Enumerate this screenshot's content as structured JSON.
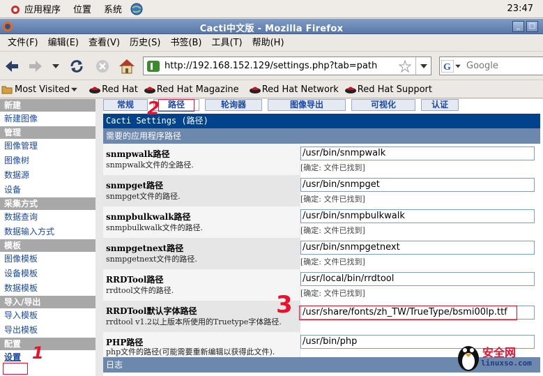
{
  "panel": {
    "apps": "应用程序",
    "places": "位置",
    "system": "系统",
    "clock": "23:47"
  },
  "window": {
    "title": "Cacti中文版 - Mozilla Firefox"
  },
  "menubar": [
    "文件(F)",
    "编辑(E)",
    "查看(V)",
    "历史(S)",
    "书签(B)",
    "工具(T)",
    "帮助(H)"
  ],
  "nav": {
    "url": "http://192.168.152.129/settings.php?tab=path",
    "search_placeholder": "Google"
  },
  "bookmarks": {
    "most_visited": "Most Visited",
    "items": [
      "Red Hat",
      "Red Hat Magazine",
      "Red Hat Network",
      "Red Hat Support"
    ]
  },
  "sidebar": {
    "h_new": "新建",
    "new_graph": "新建图像",
    "h_manage": "管理",
    "graph_mgmt": "图像管理",
    "graph_tree": "图像树",
    "data_source": "数据源",
    "device": "设备",
    "h_collect": "采集方式",
    "data_query": "数据查询",
    "data_input": "数据输入方式",
    "h_template": "模板",
    "graph_tpl": "图像模板",
    "device_tpl": "设备模板",
    "data_tpl": "数据模板",
    "h_io": "导入/导出",
    "import_tpl": "导入模板",
    "export_tpl": "导出模板",
    "h_config": "配置",
    "settings": "设置"
  },
  "tabs": [
    "常规",
    "路径",
    "轮询器",
    "图像导出",
    "可视化",
    "认证"
  ],
  "header": {
    "title": "Cacti Settings (路径)",
    "section": "需要的应用程序路径",
    "log": "日志"
  },
  "rows": [
    {
      "title": "snmpwalk路径",
      "desc": "snmpwalk文件的全路径.",
      "value": "/usr/bin/snmpwalk",
      "status": "[确定: 文件已找到]"
    },
    {
      "title": "snmpget路径",
      "desc": "snmpget文件的路径.",
      "value": "/usr/bin/snmpget",
      "status": "[确定: 文件已找到]"
    },
    {
      "title": "snmpbulkwalk路径",
      "desc": "snmpbulkwalk文件的路径.",
      "value": "/usr/bin/snmpbulkwalk",
      "status": "[确定: 文件已找到]"
    },
    {
      "title": "snmpgetnext路径",
      "desc": "snmpgetnext文件的路径.",
      "value": "/usr/bin/snmpgetnext",
      "status": "[确定: 文件已找到]"
    },
    {
      "title": "RRDTool路径",
      "desc": "rrdtool文件的路径.",
      "value": "/usr/local/bin/rrdtool",
      "status": "[确定: 文件已找到]"
    },
    {
      "title": "RRDTool默认字体路径",
      "desc": "rrdtool v1.2以上版本所使用的Truetype字体路径.",
      "value": "/usr/share/fonts/zh_TW/TrueType/bsmi00lp.ttf",
      "status": ""
    },
    {
      "title": "PHP路径",
      "desc": "php文件的路径(可能需要重新编辑以获得此文件).",
      "value": "/usr/bin/php",
      "status": ""
    }
  ],
  "annotations": [
    "1",
    "2",
    "3"
  ],
  "watermark": {
    "text": "安全网",
    "url": "linuxso.com"
  },
  "colors": {
    "accent": "#00438c",
    "subheader": "#6d88ad",
    "sidebar_head": "#a8a8a8",
    "link": "#1c4aa3",
    "annotation": "#e8122c"
  }
}
